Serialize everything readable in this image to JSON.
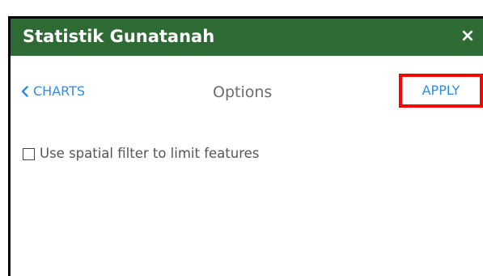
{
  "panel": {
    "title": "Statistik Gunatanah",
    "close_glyph": "×",
    "close_icon": "close-icon"
  },
  "toolbar": {
    "back_label": "CHARTS",
    "back_icon": "chevron-left-icon",
    "title": "Options",
    "apply_label": "APPLY"
  },
  "options": {
    "spatial_filter": {
      "label": "Use spatial filter to limit features",
      "checked": false
    }
  },
  "colors": {
    "header_bg": "#2e6b34",
    "link": "#2f8de4",
    "highlight": "#ff0000"
  }
}
